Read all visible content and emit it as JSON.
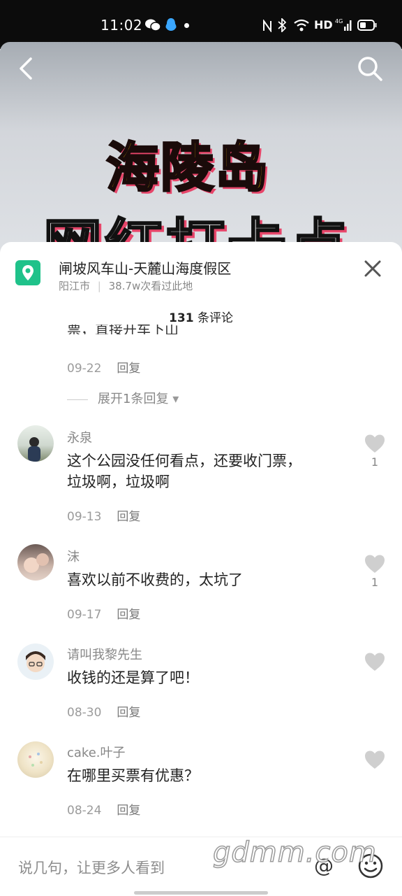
{
  "status_bar": {
    "time": "11:02",
    "network": "HD",
    "signal_label": "4G"
  },
  "hero": {
    "line1": "海陵岛",
    "line2": "网红打卡点"
  },
  "location": {
    "title": "闸坡风车山-天麓山海度假区",
    "city": "阳江市",
    "separator": "|",
    "views": "38.7w次看过此地"
  },
  "comments_header": {
    "count": "131",
    "label": "条评论"
  },
  "partial_comment": {
    "text_fragment": "票，直接开车下山",
    "date": "09-22",
    "reply": "回复"
  },
  "expand_replies": {
    "label": "展开1条回复",
    "arrow": "▾"
  },
  "comments": [
    {
      "user": "永泉",
      "line1": "这个公园没任何看点，还要收门票，",
      "line2": "垃圾啊，垃圾啊",
      "date": "09-13",
      "reply": "回复",
      "likes": "1"
    },
    {
      "user": "沫",
      "line1": "喜欢以前不收费的，太坑了",
      "date": "09-17",
      "reply": "回复",
      "likes": "1"
    },
    {
      "user": "请叫我黎先生",
      "line1": "收钱的还是算了吧！",
      "date": "08-30",
      "reply": "回复",
      "likes": ""
    },
    {
      "user": "cake.叶子",
      "line1": "在哪里买票有优惠？",
      "date": "08-24",
      "reply": "回复",
      "likes": ""
    }
  ],
  "input": {
    "placeholder": "说几句，让更多人看到",
    "at": "@"
  },
  "watermark": "gdmm.com",
  "icons": [
    "back-icon",
    "search-icon",
    "location-pin-icon",
    "close-icon",
    "heart-icon",
    "emoji-icon",
    "wechat-icon",
    "qq-icon",
    "nfc-icon",
    "bluetooth-icon",
    "wifi-icon",
    "battery-icon"
  ]
}
